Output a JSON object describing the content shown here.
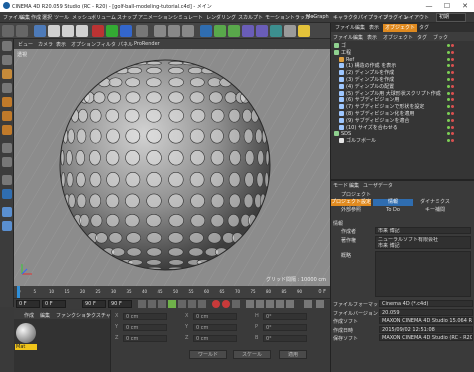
{
  "window": {
    "title": "CINEMA 4D R20.059 Studio (RC - R20) - [golf-ball-modeling-tutorial.c4d] - メイン",
    "minimize": "—",
    "maximize": "☐",
    "close": "✕"
  },
  "menubar": {
    "items": [
      "ファイル",
      "編集",
      "作成",
      "選択",
      "ツール",
      "メッシュ",
      "ボリューム",
      "スナップ",
      "アニメーション",
      "シミュレート",
      "レンダリング",
      "スカルプト",
      "モーショントラッカー",
      "MoGraph",
      "キャラクタ",
      "パイプライン",
      "プラグイン",
      "レイアウト"
    ],
    "layout_value": "初期"
  },
  "viewport": {
    "menu": [
      "ビュー",
      "カメラ",
      "表示",
      "オプション",
      "フィルタ",
      "パネル",
      "ProRender"
    ],
    "label": "透視",
    "grid_label": "グリッド間隔 : 10000 cm"
  },
  "timeline": {
    "ticks": [
      "0",
      "5",
      "10",
      "15",
      "20",
      "25",
      "30",
      "35",
      "40",
      "45",
      "50",
      "55",
      "60",
      "65",
      "70",
      "75",
      "80",
      "85",
      "90"
    ],
    "end_label": "0 F"
  },
  "transport": {
    "start_frame": "0 F",
    "current_frame": "0 F",
    "end_frame": "90 F",
    "max_frame": "90 F"
  },
  "material_manager": {
    "menu": [
      "作成",
      "編集",
      "ファンクション",
      "テクスチャ"
    ],
    "material_name": "Mat"
  },
  "coordinates": {
    "rows": [
      {
        "axis": "X",
        "pos": "0 cm",
        "axis2": "X",
        "size": "0 cm",
        "axis3": "H",
        "rot": "0°"
      },
      {
        "axis": "Y",
        "pos": "0 cm",
        "axis2": "Y",
        "size": "0 cm",
        "axis3": "P",
        "rot": "0°"
      },
      {
        "axis": "Z",
        "pos": "0 cm",
        "axis2": "Z",
        "size": "0 cm",
        "axis3": "B",
        "rot": "0°"
      }
    ],
    "mode1": "ワールド",
    "mode2": "スケール",
    "apply": "適用"
  },
  "object_manager": {
    "tabs": [
      "ファイル",
      "編集",
      "表示",
      "オブジェクト",
      "タグ"
    ],
    "tab_active": "オブジェクト",
    "menu": [
      "ファイル",
      "編集",
      "表示",
      "オブジェクト",
      "タグ",
      "ブック"
    ],
    "rows": [
      {
        "indent": 0,
        "label": "ゴ",
        "color": "#8fd18f"
      },
      {
        "indent": 0,
        "label": "工程",
        "color": "#8fd18f"
      },
      {
        "indent": 1,
        "label": "Ref",
        "color": "#e0a040"
      },
      {
        "indent": 1,
        "label": "(1) 構造の作成 を表示",
        "color": "#9ec7ff"
      },
      {
        "indent": 1,
        "label": "(2) ディンプルを作成",
        "color": "#9ec7ff"
      },
      {
        "indent": 1,
        "label": "(3) ディンプルを作成",
        "color": "#9ec7ff"
      },
      {
        "indent": 1,
        "label": "(4) ディンプルの配置",
        "color": "#9ec7ff"
      },
      {
        "indent": 1,
        "label": "(5) ディンプル用 大球形状スクリプト作成",
        "color": "#9ec7ff"
      },
      {
        "indent": 1,
        "label": "(6) サブディビジョン用",
        "color": "#9ec7ff"
      },
      {
        "indent": 1,
        "label": "(7) サブディビジョンで形状を設定",
        "color": "#9ec7ff"
      },
      {
        "indent": 1,
        "label": "(8) サブディビジョン化を適用",
        "color": "#9ec7ff"
      },
      {
        "indent": 1,
        "label": "(9) サブディビジョンを適合",
        "color": "#9ec7ff"
      },
      {
        "indent": 1,
        "label": "(10) サイズを合わせる",
        "color": "#9ec7ff"
      },
      {
        "indent": 0,
        "label": "SDS",
        "color": "#8fd18f"
      },
      {
        "indent": 1,
        "label": "ゴルフボール",
        "color": "#e6e6e6"
      }
    ]
  },
  "attributes": {
    "menu": [
      "モード",
      "編集",
      "ユーザデータ"
    ],
    "section": "プロジェクト",
    "tabs_row1": [
      "プロジェクト設定",
      "情報",
      "ダイナミクス"
    ],
    "tabs_row2": [
      "外部参照",
      "To Do",
      "キー補間"
    ],
    "info_header": "情報",
    "fields": [
      {
        "label": "作成者",
        "value": "市来 博記"
      },
      {
        "label": "著作権",
        "value": "ニューラルソフト有限会社\n市来 博記"
      },
      {
        "label": "概略",
        "value": ""
      }
    ],
    "file_fields": [
      {
        "label": "ファイルフォーマット",
        "value": "Cinema 4D (*.c4d)"
      },
      {
        "label": "ファイルバージョン",
        "value": "20.059"
      },
      {
        "label": "作成ソフト",
        "value": "MAXON CINEMA 4D Studio 15.064 RC"
      },
      {
        "label": "作成日時",
        "value": "2015/09/02 12:51:08"
      },
      {
        "label": "保存ソフト",
        "value": "MAXON CINEMA 4D Studio (RC - R20"
      }
    ]
  },
  "colors": {
    "accent_orange": "#e08a1f",
    "accent_blue": "#2f6db0",
    "material_label": "#f0c419"
  }
}
